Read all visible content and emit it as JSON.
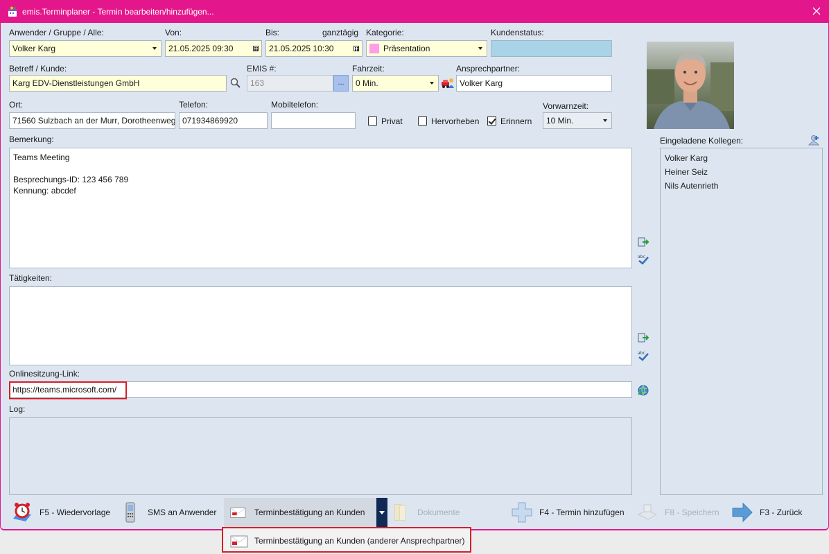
{
  "window": {
    "title": "emis.Terminplaner - Termin bearbeiten/hinzufügen...",
    "accent_color": "#e4168b"
  },
  "labels": {
    "anwender": "Anwender / Gruppe / Alle:",
    "von": "Von:",
    "bis": "Bis:",
    "ganztaegig": "ganztägig",
    "kategorie": "Kategorie:",
    "kundenstatus": "Kundenstatus:",
    "betreff": "Betreff / Kunde:",
    "emis": "EMIS #:",
    "fahrzeit": "Fahrzeit:",
    "ansprechpartner": "Ansprechpartner:",
    "ort": "Ort:",
    "telefon": "Telefon:",
    "mobiltelefon": "Mobiltelefon:",
    "vorwarnzeit": "Vorwarnzeit:",
    "bemerkung": "Bemerkung:",
    "taetigkeiten": "Tätigkeiten:",
    "onlinelink": "Onlinesitzung-Link:",
    "log": "Log:",
    "kollegen": "Eingeladene Kollegen:"
  },
  "fields": {
    "anwender": "Volker Karg",
    "von": "21.05.2025 09:30",
    "bis": "21.05.2025 10:30",
    "kategorie": "Präsentation",
    "kundenstatus": "",
    "betreff": "Karg EDV-Dienstleistungen GmbH",
    "emis": "163",
    "emis_button": "...",
    "fahrzeit": "0 Min.",
    "ansprechpartner": "Volker Karg",
    "ort": "71560 Sulzbach an der Murr, Dorotheenweg",
    "telefon": "071934869920",
    "mobiltelefon": "",
    "vorwarnzeit": "10 Min.",
    "bemerkung": "Teams Meeting\n\nBesprechungs-ID: 123 456 789\nKennung: abcdef",
    "taetigkeiten": "",
    "onlinelink": "https://teams.microsoft.com/",
    "log": ""
  },
  "checkboxes": {
    "privat": {
      "label": "Privat",
      "checked": false
    },
    "hervorheben": {
      "label": "Hervorheben",
      "checked": false
    },
    "erinnern": {
      "label": "Erinnern",
      "checked": true
    }
  },
  "colleagues": [
    "Volker Karg",
    "Heiner Seiz",
    "Nils Autenrieth"
  ],
  "toolbar": {
    "wiedervorlage": "F5 - Wiedervorlage",
    "sms": "SMS an Anwender",
    "terminbestaetigung": "Terminbestätigung an Kunden",
    "dokumente": "Dokumente",
    "hinzufuegen": "F4 - Termin hinzufügen",
    "speichern": "F8 - Speichern",
    "zurueck": "F3 - Zurück"
  },
  "dropdown": {
    "item": "Terminbestätigung an Kunden (anderer Ansprechpartner)"
  }
}
